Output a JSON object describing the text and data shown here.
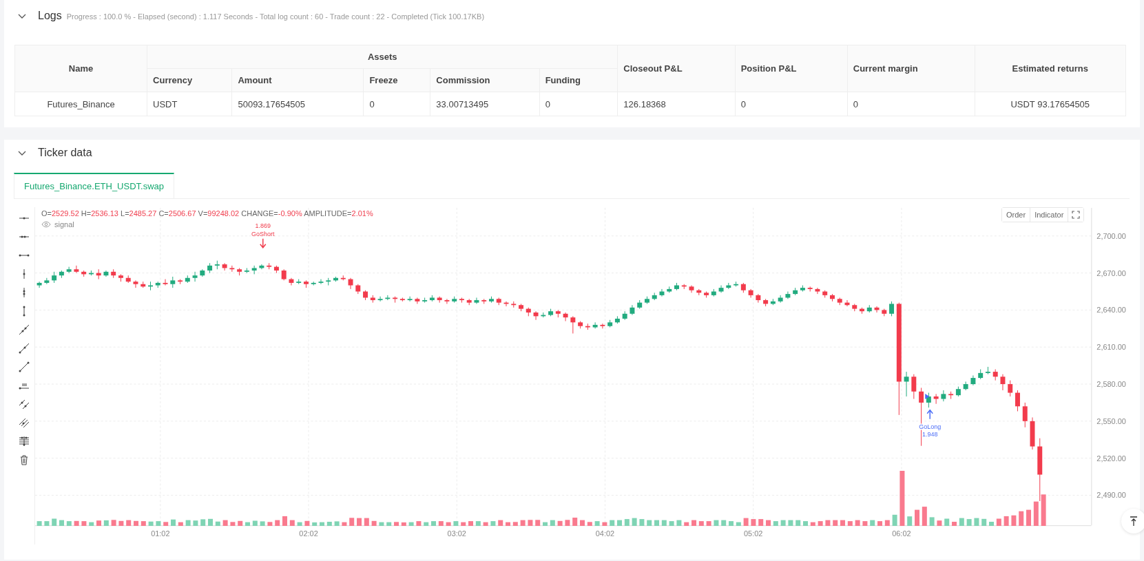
{
  "logs": {
    "title": "Logs",
    "expanded": true,
    "summary": "Progress : 100.0 % - Elapsed (second) : 1.117  Seconds - Total log count : 60 - Trade count : 22 - Completed (Tick 100.17KB)",
    "table": {
      "header": [
        {
          "label": "Name",
          "kind": "single"
        },
        {
          "label": "Assets",
          "kind": "group"
        },
        {
          "label": "Closeout P&L",
          "kind": "single"
        },
        {
          "label": "Position P&L",
          "kind": "single"
        },
        {
          "label": "Current margin",
          "kind": "single"
        },
        {
          "label": "Estimated returns",
          "kind": "single"
        }
      ],
      "sub_columns": [
        "Currency",
        "Amount",
        "Freeze",
        "Commission",
        "Funding"
      ],
      "rows": [
        [
          "Futures_Binance",
          "USDT",
          "50093.17654505",
          "0",
          "33.00713495",
          "0",
          "126.18368",
          "0",
          "0",
          "USDT 93.17654505"
        ]
      ]
    }
  },
  "ticker": {
    "title": "Ticker data",
    "expanded": true,
    "tabs": [
      {
        "label": "Futures_Binance.ETH_USDT.swap",
        "selected": true
      }
    ],
    "legend": [
      {
        "key": "O=",
        "value": "2529.52"
      },
      {
        "key": "H=",
        "value": "2536.13"
      },
      {
        "key": "L=",
        "value": "2485.27"
      },
      {
        "key": "C=",
        "value": "2506.67"
      },
      {
        "key": "V=",
        "value": "99248.02"
      },
      {
        "key": "CHANGE=",
        "value": "-0.90%"
      },
      {
        "key": "AMPLITUDE=",
        "value": "2.01%"
      }
    ],
    "series_label": "signal",
    "buttons": [
      "Order",
      "Indicator"
    ],
    "chart_data": {
      "type": "candlestick",
      "grid": true,
      "xlim": [
        11.3,
        438.8
      ],
      "ylim": [
        2465.6,
        2722.8
      ],
      "yticks": [
        {
          "value": 2700,
          "label": "2,700.00"
        },
        {
          "value": 2670,
          "label": "2,670.00"
        },
        {
          "value": 2640,
          "label": "2,640.00"
        },
        {
          "value": 2610,
          "label": "2,610.00"
        },
        {
          "value": 2580,
          "label": "2,580.00"
        },
        {
          "value": 2550,
          "label": "2,550.00"
        },
        {
          "value": 2520,
          "label": "2,520.00"
        },
        {
          "value": 2490,
          "label": "2,490.00"
        }
      ],
      "xticks": [
        {
          "value": 62,
          "label": "01:02"
        },
        {
          "value": 122,
          "label": "02:02"
        },
        {
          "value": 182,
          "label": "03:02"
        },
        {
          "value": 242,
          "label": "04:02"
        },
        {
          "value": 302,
          "label": "05:02"
        },
        {
          "value": 362,
          "label": "06:02"
        }
      ],
      "x": [
        13,
        16,
        19,
        22,
        25,
        28,
        31,
        34,
        37,
        40,
        43,
        46,
        49,
        52,
        55,
        58,
        61,
        64,
        67,
        70,
        73,
        76,
        79,
        82,
        85,
        88,
        91,
        94,
        97,
        100,
        103,
        106,
        109,
        112,
        115,
        118,
        121,
        124,
        127,
        130,
        133,
        136,
        139,
        142,
        145,
        148,
        151,
        154,
        157,
        160,
        163,
        166,
        169,
        172,
        175,
        178,
        181,
        184,
        187,
        190,
        193,
        196,
        199,
        202,
        205,
        208,
        211,
        214,
        217,
        220,
        223,
        226,
        229,
        232,
        235,
        238,
        241,
        244,
        247,
        250,
        253,
        256,
        259,
        262,
        265,
        268,
        271,
        274,
        277,
        280,
        283,
        286,
        289,
        292,
        295,
        298,
        301,
        304,
        307,
        310,
        313,
        316,
        319,
        322,
        325,
        328,
        331,
        334,
        337,
        340,
        343,
        346,
        349,
        352,
        355,
        358,
        361,
        364,
        367,
        370,
        373,
        376,
        379,
        382,
        385,
        388,
        391,
        394,
        397,
        400,
        403,
        406,
        409,
        412,
        415,
        418
      ],
      "ohlc": [
        [
          2660,
          2663,
          2658,
          2662
        ],
        [
          2662,
          2666,
          2661,
          2664
        ],
        [
          2664,
          2671,
          2662,
          2668
        ],
        [
          2668,
          2672,
          2666,
          2671
        ],
        [
          2671,
          2675,
          2670,
          2673
        ],
        [
          2673,
          2676,
          2670,
          2671
        ],
        [
          2671,
          2672,
          2667,
          2669
        ],
        [
          2669,
          2672,
          2668,
          2670
        ],
        [
          2670,
          2673,
          2665,
          2668
        ],
        [
          2668,
          2672,
          2667,
          2671
        ],
        [
          2671,
          2673,
          2666,
          2668
        ],
        [
          2668,
          2669,
          2663,
          2666
        ],
        [
          2666,
          2668,
          2662,
          2663
        ],
        [
          2663,
          2664,
          2658,
          2661
        ],
        [
          2661,
          2663,
          2658,
          2659
        ],
        [
          2659,
          2663,
          2656,
          2660
        ],
        [
          2660,
          2663,
          2658,
          2662
        ],
        [
          2662,
          2665,
          2660,
          2661
        ],
        [
          2661,
          2667,
          2658,
          2664
        ],
        [
          2664,
          2665,
          2661,
          2663
        ],
        [
          2663,
          2668,
          2662,
          2666
        ],
        [
          2666,
          2671,
          2663,
          2668
        ],
        [
          2668,
          2673,
          2667,
          2672
        ],
        [
          2672,
          2678,
          2670,
          2676
        ],
        [
          2676,
          2680,
          2673,
          2677
        ],
        [
          2677,
          2678,
          2672,
          2674
        ],
        [
          2674,
          2676,
          2671,
          2673
        ],
        [
          2673,
          2674,
          2668,
          2671
        ],
        [
          2671,
          2674,
          2670,
          2672
        ],
        [
          2672,
          2676,
          2669,
          2674
        ],
        [
          2674,
          2677,
          2673,
          2676
        ],
        [
          2676,
          2678,
          2673,
          2675
        ],
        [
          2675,
          2676,
          2670,
          2672
        ],
        [
          2672,
          2673,
          2664,
          2665
        ],
        [
          2665,
          2666,
          2660,
          2662
        ],
        [
          2662,
          2665,
          2661,
          2663
        ],
        [
          2663,
          2664,
          2658,
          2661
        ],
        [
          2661,
          2663,
          2660,
          2662
        ],
        [
          2662,
          2665,
          2661,
          2663
        ],
        [
          2663,
          2666,
          2660,
          2664
        ],
        [
          2664,
          2667,
          2663,
          2666
        ],
        [
          2666,
          2668,
          2664,
          2665
        ],
        [
          2665,
          2666,
          2657,
          2660
        ],
        [
          2660,
          2661,
          2653,
          2655
        ],
        [
          2655,
          2656,
          2648,
          2650
        ],
        [
          2650,
          2652,
          2646,
          2648
        ],
        [
          2648,
          2651,
          2647,
          2649
        ],
        [
          2649,
          2652,
          2648,
          2650
        ],
        [
          2650,
          2651,
          2646,
          2649
        ],
        [
          2649,
          2650,
          2647,
          2648
        ],
        [
          2648,
          2651,
          2647,
          2649
        ],
        [
          2649,
          2650,
          2645,
          2647
        ],
        [
          2647,
          2650,
          2646,
          2648
        ],
        [
          2648,
          2652,
          2647,
          2650
        ],
        [
          2650,
          2651,
          2646,
          2648
        ],
        [
          2648,
          2649,
          2645,
          2647
        ],
        [
          2647,
          2651,
          2646,
          2649
        ],
        [
          2649,
          2650,
          2646,
          2648
        ],
        [
          2648,
          2649,
          2644,
          2646
        ],
        [
          2646,
          2650,
          2645,
          2648
        ],
        [
          2648,
          2649,
          2645,
          2647
        ],
        [
          2647,
          2651,
          2646,
          2649
        ],
        [
          2649,
          2650,
          2644,
          2646
        ],
        [
          2646,
          2647,
          2643,
          2645
        ],
        [
          2645,
          2647,
          2642,
          2644
        ],
        [
          2644,
          2645,
          2639,
          2641
        ],
        [
          2641,
          2642,
          2635,
          2638
        ],
        [
          2638,
          2639,
          2632,
          2635
        ],
        [
          2635,
          2638,
          2634,
          2636
        ],
        [
          2636,
          2641,
          2635,
          2639
        ],
        [
          2639,
          2640,
          2634,
          2637
        ],
        [
          2637,
          2638,
          2631,
          2634
        ],
        [
          2634,
          2635,
          2621,
          2630
        ],
        [
          2630,
          2631,
          2625,
          2627
        ],
        [
          2627,
          2629,
          2624,
          2626
        ],
        [
          2626,
          2630,
          2625,
          2628
        ],
        [
          2628,
          2629,
          2625,
          2627
        ],
        [
          2627,
          2632,
          2626,
          2630
        ],
        [
          2630,
          2635,
          2629,
          2633
        ],
        [
          2633,
          2639,
          2632,
          2637
        ],
        [
          2637,
          2644,
          2636,
          2642
        ],
        [
          2642,
          2648,
          2641,
          2646
        ],
        [
          2646,
          2651,
          2645,
          2649
        ],
        [
          2649,
          2654,
          2648,
          2652
        ],
        [
          2652,
          2657,
          2651,
          2655
        ],
        [
          2655,
          2659,
          2654,
          2657
        ],
        [
          2657,
          2662,
          2656,
          2660
        ],
        [
          2660,
          2661,
          2657,
          2659
        ],
        [
          2659,
          2660,
          2654,
          2656
        ],
        [
          2656,
          2657,
          2652,
          2654
        ],
        [
          2654,
          2655,
          2650,
          2652
        ],
        [
          2652,
          2657,
          2651,
          2655
        ],
        [
          2655,
          2660,
          2654,
          2658
        ],
        [
          2658,
          2662,
          2657,
          2660
        ],
        [
          2660,
          2663,
          2659,
          2661
        ],
        [
          2661,
          2662,
          2654,
          2656
        ],
        [
          2656,
          2657,
          2650,
          2652
        ],
        [
          2652,
          2653,
          2646,
          2648
        ],
        [
          2648,
          2649,
          2643,
          2645
        ],
        [
          2645,
          2649,
          2644,
          2647
        ],
        [
          2647,
          2652,
          2646,
          2650
        ],
        [
          2650,
          2655,
          2649,
          2653
        ],
        [
          2653,
          2658,
          2652,
          2656
        ],
        [
          2656,
          2660,
          2655,
          2658
        ],
        [
          2658,
          2659,
          2655,
          2657
        ],
        [
          2657,
          2658,
          2653,
          2655
        ],
        [
          2655,
          2656,
          2650,
          2652
        ],
        [
          2652,
          2653,
          2647,
          2649
        ],
        [
          2649,
          2650,
          2644,
          2646
        ],
        [
          2646,
          2648,
          2643,
          2644
        ],
        [
          2644,
          2645,
          2639,
          2641
        ],
        [
          2641,
          2642,
          2637,
          2639
        ],
        [
          2639,
          2644,
          2638,
          2642
        ],
        [
          2642,
          2643,
          2638,
          2640
        ],
        [
          2640,
          2641,
          2635,
          2637
        ],
        [
          2637,
          2647,
          2635,
          2645
        ],
        [
          2645,
          2646,
          2555,
          2582
        ],
        [
          2582,
          2590,
          2570,
          2586
        ],
        [
          2586,
          2588,
          2568,
          2574
        ],
        [
          2574,
          2577,
          2530,
          2565
        ],
        [
          2565,
          2573,
          2561,
          2570
        ],
        [
          2570,
          2572,
          2564,
          2568
        ],
        [
          2568,
          2575,
          2566,
          2572
        ],
        [
          2572,
          2574,
          2568,
          2571
        ],
        [
          2571,
          2578,
          2570,
          2576
        ],
        [
          2576,
          2582,
          2575,
          2580
        ],
        [
          2580,
          2587,
          2579,
          2585
        ],
        [
          2585,
          2592,
          2584,
          2589
        ],
        [
          2589,
          2594,
          2588,
          2590
        ],
        [
          2590,
          2592,
          2583,
          2586
        ],
        [
          2586,
          2588,
          2575,
          2580
        ],
        [
          2580,
          2583,
          2570,
          2573
        ],
        [
          2573,
          2575,
          2558,
          2562
        ],
        [
          2562,
          2565,
          2545,
          2550
        ],
        [
          2550,
          2553,
          2527,
          2529.52
        ],
        [
          2529.52,
          2536.13,
          2485.27,
          2506.67
        ]
      ]
    },
    "signals": [
      {
        "kind": "short",
        "value": "1.869",
        "label": "GoShort"
      },
      {
        "kind": "long",
        "value": "1.948",
        "label": "GoLong"
      }
    ]
  }
}
